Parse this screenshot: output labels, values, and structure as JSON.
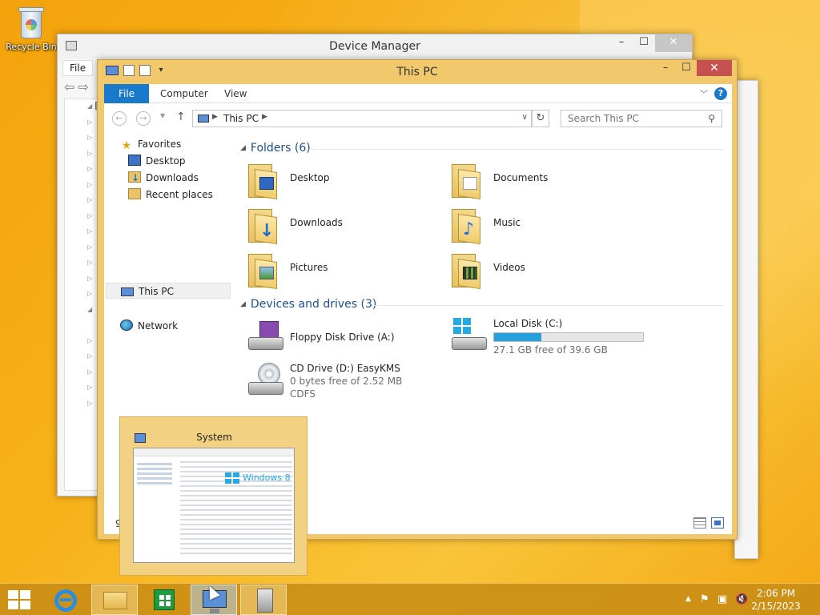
{
  "desktop": {
    "recycle_bin_label": "Recycle Bin"
  },
  "device_manager": {
    "title": "Device Manager",
    "menu_file": "File",
    "controls": {
      "minimize": "–",
      "maximize": "☐",
      "close": "✕"
    }
  },
  "explorer": {
    "title": "This PC",
    "controls": {
      "minimize": "–",
      "maximize": "☐",
      "close": "✕"
    },
    "ribbon_tabs": [
      "File",
      "Computer",
      "View"
    ],
    "help": "?",
    "address": {
      "location": "This PC"
    },
    "search": {
      "placeholder": "Search This PC"
    },
    "nav": {
      "favorites": "Favorites",
      "desktop": "Desktop",
      "downloads": "Downloads",
      "recent_places": "Recent places",
      "this_pc": "This PC",
      "network": "Network"
    },
    "folders_header": "Folders (6)",
    "folders": [
      "Desktop",
      "Documents",
      "Downloads",
      "Music",
      "Pictures",
      "Videos"
    ],
    "devices_header": "Devices and drives (3)",
    "drives": {
      "floppy": {
        "name": "Floppy Disk Drive (A:)"
      },
      "local": {
        "name": "Local Disk (C:)",
        "free": "27.1 GB free of 39.6 GB",
        "used_fraction": 0.316
      },
      "cd": {
        "name": "CD Drive (D:) EasyKMS",
        "free": "0 bytes free of 2.52 MB",
        "fs": "CDFS"
      }
    },
    "status_count": "9"
  },
  "thumbnail": {
    "title": "System",
    "brand": "Windows 8"
  },
  "taskbar": {
    "time": "2:06 PM",
    "date": "2/15/2023"
  },
  "colors": {
    "accent": "#1979ca",
    "window_frame": "#f2c86c",
    "close_red": "#c75050",
    "drive_bar": "#26a0da"
  }
}
